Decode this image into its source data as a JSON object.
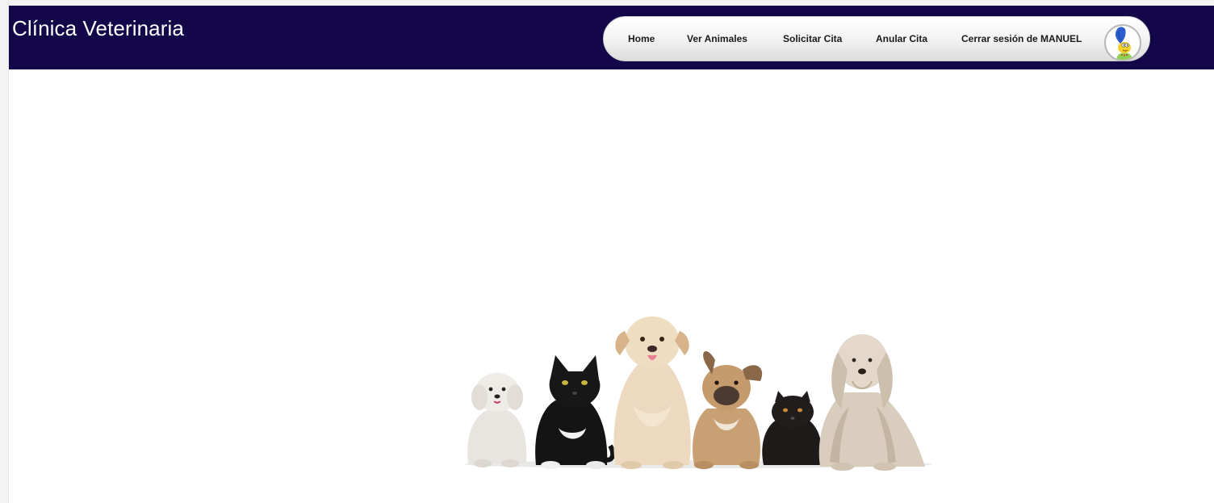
{
  "header": {
    "brand": "Clínica Veterinaria",
    "background": "#130749"
  },
  "nav": {
    "items": [
      {
        "label": "Home"
      },
      {
        "label": "Ver Animales"
      },
      {
        "label": "Solicitar Cita"
      },
      {
        "label": "Anular Cita"
      },
      {
        "label": "Cerrar sesión de MANUEL"
      }
    ],
    "avatar_icon": "user-avatar-icon"
  },
  "hero": {
    "icon": "pets-group-image"
  }
}
